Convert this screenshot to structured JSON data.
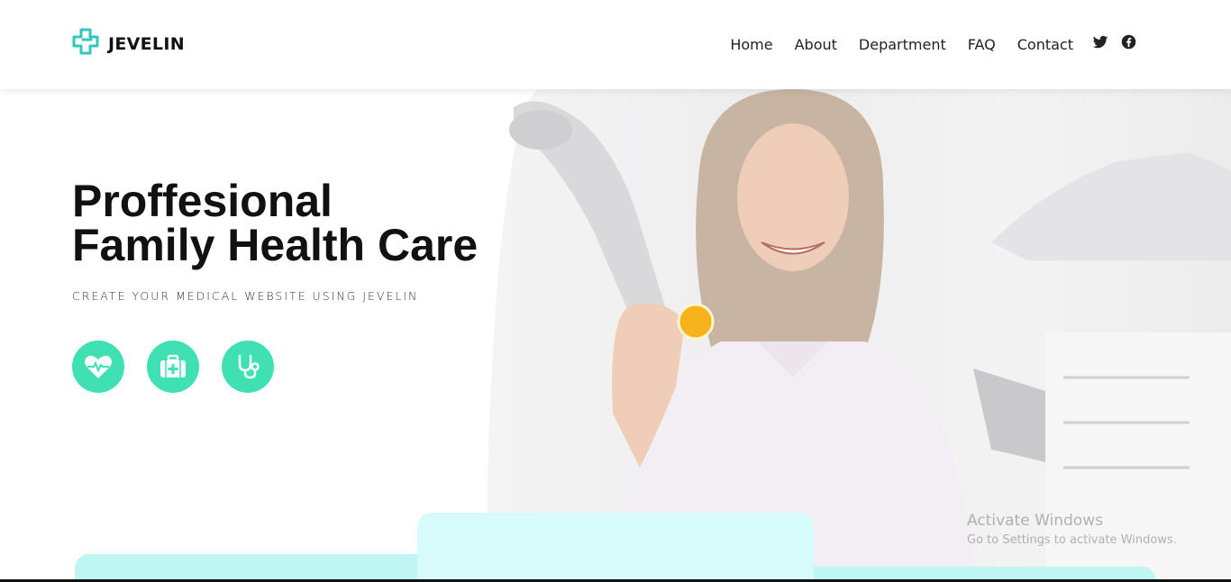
{
  "brand": {
    "name": "JEVELIN",
    "logo_icon": "medical-cross-icon"
  },
  "nav": {
    "items": [
      "Home",
      "About",
      "Department",
      "FAQ",
      "Contact"
    ]
  },
  "social": [
    "twitter-icon",
    "facebook-icon"
  ],
  "hero": {
    "title_line1": "Proffesional",
    "title_line2": "Family Health Care",
    "subtitle": "CREATE YOUR MEDICAL WEBSITE USING JEVELIN",
    "feature_icons": [
      "heartbeat-icon",
      "medical-kit-icon",
      "stethoscope-icon"
    ]
  },
  "watermark": {
    "line1": "Activate Windows",
    "line2": "Go to Settings to activate Windows."
  },
  "colors": {
    "accent": "#3fe0b2",
    "logo": "#2fc7bd",
    "card_light": "#d6fbfa",
    "card": "#bff5f3"
  }
}
